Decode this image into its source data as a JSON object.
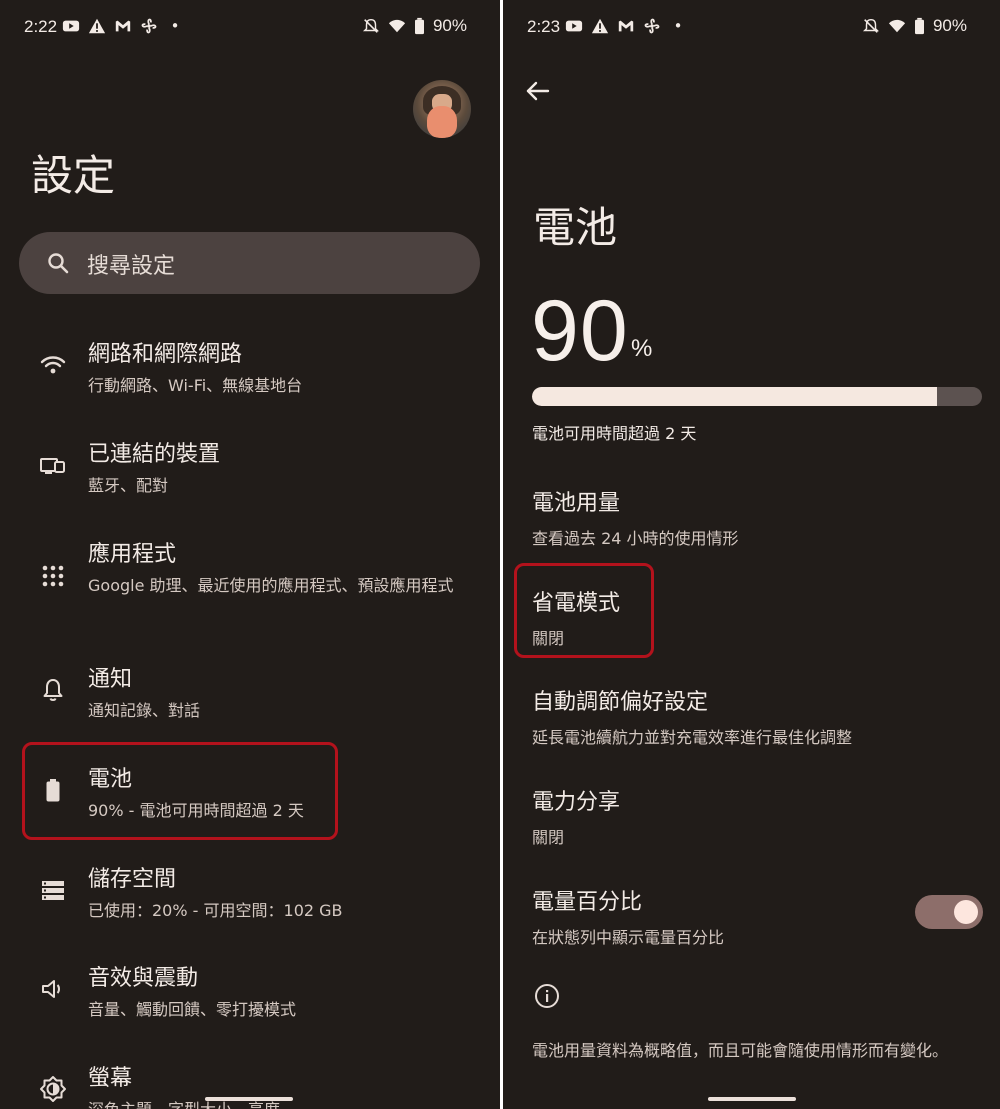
{
  "left_screen": {
    "status_bar": {
      "time": "2:22",
      "battery_percent": "90%"
    },
    "title": "設定",
    "search": {
      "placeholder": "搜尋設定"
    },
    "items": [
      {
        "title": "網路和網際網路",
        "subtitle": "行動網路、Wi-Fi、無線基地台",
        "icon": "wifi-icon"
      },
      {
        "title": "已連結的裝置",
        "subtitle": "藍牙、配對",
        "icon": "connected-devices-icon"
      },
      {
        "title": "應用程式",
        "subtitle": "Google 助理、最近使用的應用程式、預設應用程式",
        "icon": "apps-grid-icon"
      },
      {
        "title": "通知",
        "subtitle": "通知記錄、對話",
        "icon": "bell-icon"
      },
      {
        "title": "電池",
        "subtitle": "90% - 電池可用時間超過 2 天",
        "icon": "battery-icon"
      },
      {
        "title": "儲存空間",
        "subtitle": "已使用：20% - 可用空間：102 GB",
        "icon": "storage-icon"
      },
      {
        "title": "音效與震動",
        "subtitle": "音量、觸動回饋、零打擾模式",
        "icon": "speaker-icon"
      },
      {
        "title": "螢幕",
        "subtitle": "深色主題、字型大小、亮度",
        "icon": "brightness-icon"
      }
    ]
  },
  "right_screen": {
    "status_bar": {
      "time": "2:23",
      "battery_percent": "90%"
    },
    "title": "電池",
    "battery_level": "90",
    "percent_sign": "%",
    "battery_fraction": 0.9,
    "battery_time": "電池可用時間超過 2 天",
    "items": [
      {
        "title": "電池用量",
        "subtitle": "查看過去 24 小時的使用情形"
      },
      {
        "title": "省電模式",
        "subtitle": "關閉"
      },
      {
        "title": "自動調節偏好設定",
        "subtitle": "延長電池續航力並對充電效率進行最佳化調整"
      },
      {
        "title": "電力分享",
        "subtitle": "關閉"
      },
      {
        "title": "電量百分比",
        "subtitle": "在狀態列中顯示電量百分比",
        "toggle_on": true
      }
    ],
    "footer_note": "電池用量資料為概略值，而且可能會隨使用情形而有變化。"
  },
  "colors": {
    "background": "#211c19",
    "highlight": "#b3121c",
    "search_bg": "#4c4240",
    "toggle_track": "#8d6e6a"
  }
}
